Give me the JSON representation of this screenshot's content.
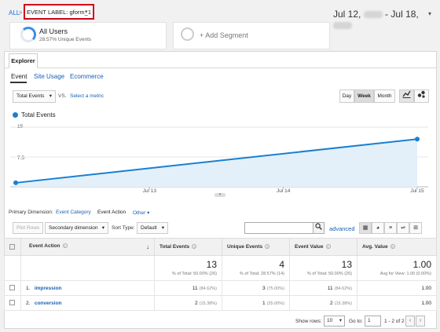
{
  "breadcrumb": {
    "all": "ALL",
    "separator": "»",
    "label": "EVENT LABEL: gform_1"
  },
  "date_range": {
    "start": "Jul 12,",
    "end": "Jul 18,"
  },
  "segments": [
    {
      "title": "All Users",
      "subtitle": "28.57% Unique Events"
    },
    {
      "title": "+ Add Segment"
    }
  ],
  "tabs": {
    "explorer": "Explorer"
  },
  "subtabs": [
    "Event",
    "Site Usage",
    "Ecommerce"
  ],
  "controls": {
    "metric_select": "Total Events",
    "vs": "VS.",
    "select_metric": "Select a metric",
    "periods": [
      "Day",
      "Week",
      "Month"
    ],
    "active_period": "Week"
  },
  "chart_data": {
    "type": "area",
    "series": [
      {
        "name": "Total Events",
        "values": [
          1,
          12
        ]
      }
    ],
    "x_start": "Jul 12",
    "x_end": "Jul 15",
    "x_ticks": [
      "Jul 13",
      "Jul 14",
      "Jul 15"
    ],
    "y_ticks": [
      "15",
      "7.5"
    ],
    "ylim": [
      0,
      15
    ],
    "color": "#1a7fd0",
    "fill": "#e3f0fa"
  },
  "dimensions": {
    "label": "Primary Dimension:",
    "options": [
      "Event Category",
      "Event Action",
      "Other"
    ],
    "active": "Event Action"
  },
  "toolbar": {
    "plot_rows": "Plot Rows",
    "secondary": "Secondary dimension",
    "sort_label": "Sort Type:",
    "sort_value": "Default",
    "advanced": "advanced"
  },
  "table": {
    "headers": [
      "Event Action",
      "Total Events",
      "Unique Events",
      "Event Value",
      "Avg. Value"
    ],
    "totals": [
      {
        "value": "13",
        "sub": "% of Total: 50.00% (26)"
      },
      {
        "value": "4",
        "sub": "% of Total: 28.57% (14)"
      },
      {
        "value": "13",
        "sub": "% of Total: 50.00% (26)"
      },
      {
        "value": "1.00",
        "sub": "Avg for View: 1.00 (0.00%)"
      }
    ],
    "rows": [
      {
        "index": "1.",
        "action": "impression",
        "total": "11",
        "total_pct": "(84.62%)",
        "unique": "3",
        "unique_pct": "(75.00%)",
        "value": "11",
        "value_pct": "(84.62%)",
        "avg": "1.00"
      },
      {
        "index": "2.",
        "action": "conversion",
        "total": "2",
        "total_pct": "(15.38%)",
        "unique": "1",
        "unique_pct": "(25.00%)",
        "value": "2",
        "value_pct": "(15.38%)",
        "avg": "1.00"
      }
    ]
  },
  "footer": {
    "show_rows_label": "Show rows:",
    "show_rows_value": "10",
    "goto_label": "Go to:",
    "goto_value": "1",
    "range": "1 - 2 of 2"
  }
}
